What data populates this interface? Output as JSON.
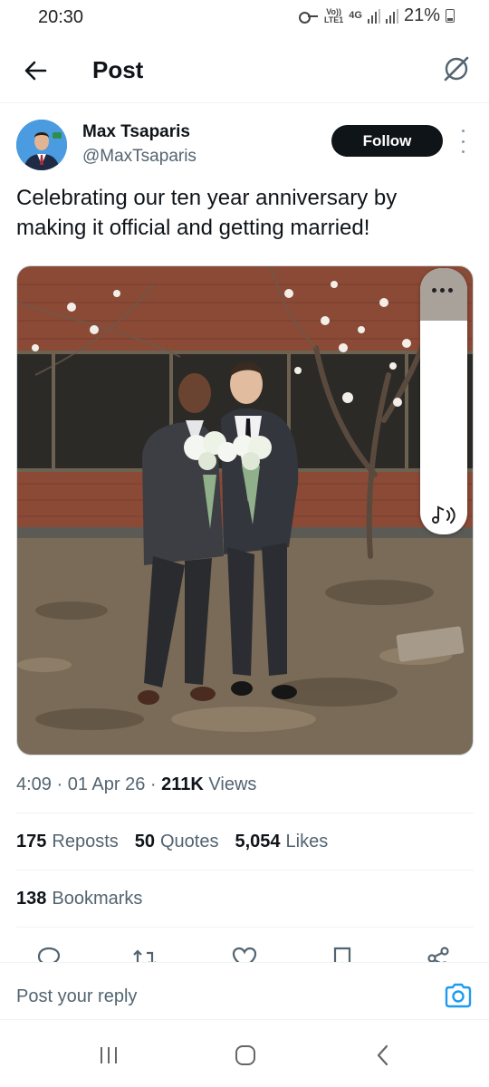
{
  "status_bar": {
    "time": "20:30",
    "volte_top": "Vo))",
    "volte_bottom": "LTE1",
    "network": "4G",
    "battery": "21%",
    "icons": [
      "key-icon",
      "volte-icon",
      "signal-icon",
      "battery-icon"
    ]
  },
  "header": {
    "title": "Post",
    "back_icon": "arrow-left-icon",
    "grok_icon": "grok-icon"
  },
  "post": {
    "author_name": "Max Tsaparis",
    "author_handle": "@MaxTsaparis",
    "follow_label": "Follow",
    "text": "Celebrating our ten year anniversary by making it official and getting married!",
    "time": "4:09",
    "date": "01 Apr 26",
    "views_count": "211K",
    "views_label": "Views",
    "reposts_count": "175",
    "reposts_label": "Reposts",
    "quotes_count": "50",
    "quotes_label": "Quotes",
    "likes_count": "5,054",
    "likes_label": "Likes",
    "bookmarks_count": "138",
    "bookmarks_label": "Bookmarks"
  },
  "actions": [
    "reply-icon",
    "repost-icon",
    "like-icon",
    "bookmark-icon",
    "share-icon"
  ],
  "reply": {
    "placeholder": "Post your reply",
    "camera_icon": "camera-icon"
  },
  "nav": [
    "recents-icon",
    "home-icon",
    "back-icon"
  ],
  "colors": {
    "text": "#0f1419",
    "muted": "#536471",
    "accent": "#1d9bf0",
    "button": "#0f1419"
  }
}
